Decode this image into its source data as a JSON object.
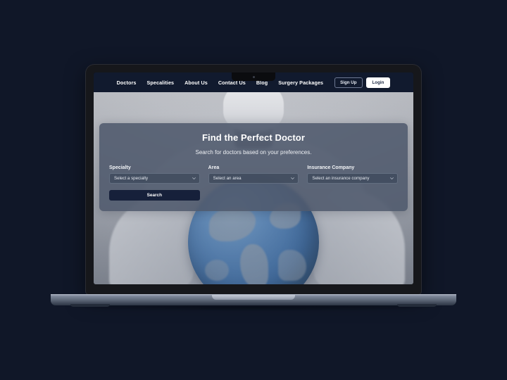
{
  "page": {
    "background_color": "#101728"
  },
  "device": {
    "type": "laptop-mockup",
    "camera_name": "webcam-dot"
  },
  "navbar": {
    "links": [
      {
        "label": "Doctors",
        "active": false
      },
      {
        "label": "Specalities",
        "active": false
      },
      {
        "label": "About Us",
        "active": false
      },
      {
        "label": "Contact Us",
        "active": true
      },
      {
        "label": "Blog",
        "active": false
      },
      {
        "label": "Surgery Packages",
        "active": false
      }
    ],
    "signup_label": "Sign Up",
    "login_label": "Login",
    "background_color": "#111a2e"
  },
  "hero": {
    "title": "Find the Perfect Doctor",
    "subtitle": "Search for doctors based on your preferences.",
    "card_color": "#4e596c",
    "image_description": "doctor-holding-globe-photo"
  },
  "search_form": {
    "fields": [
      {
        "label": "Specialty",
        "value": "Select a specialty",
        "icon": "chevron-down-icon"
      },
      {
        "label": "Area",
        "value": "Select an area",
        "icon": "chevron-down-icon"
      },
      {
        "label": "Insurance Company",
        "value": "Select an insurance company",
        "icon": "chevron-down-icon"
      }
    ],
    "submit_label": "Search",
    "submit_color": "#16203a"
  }
}
